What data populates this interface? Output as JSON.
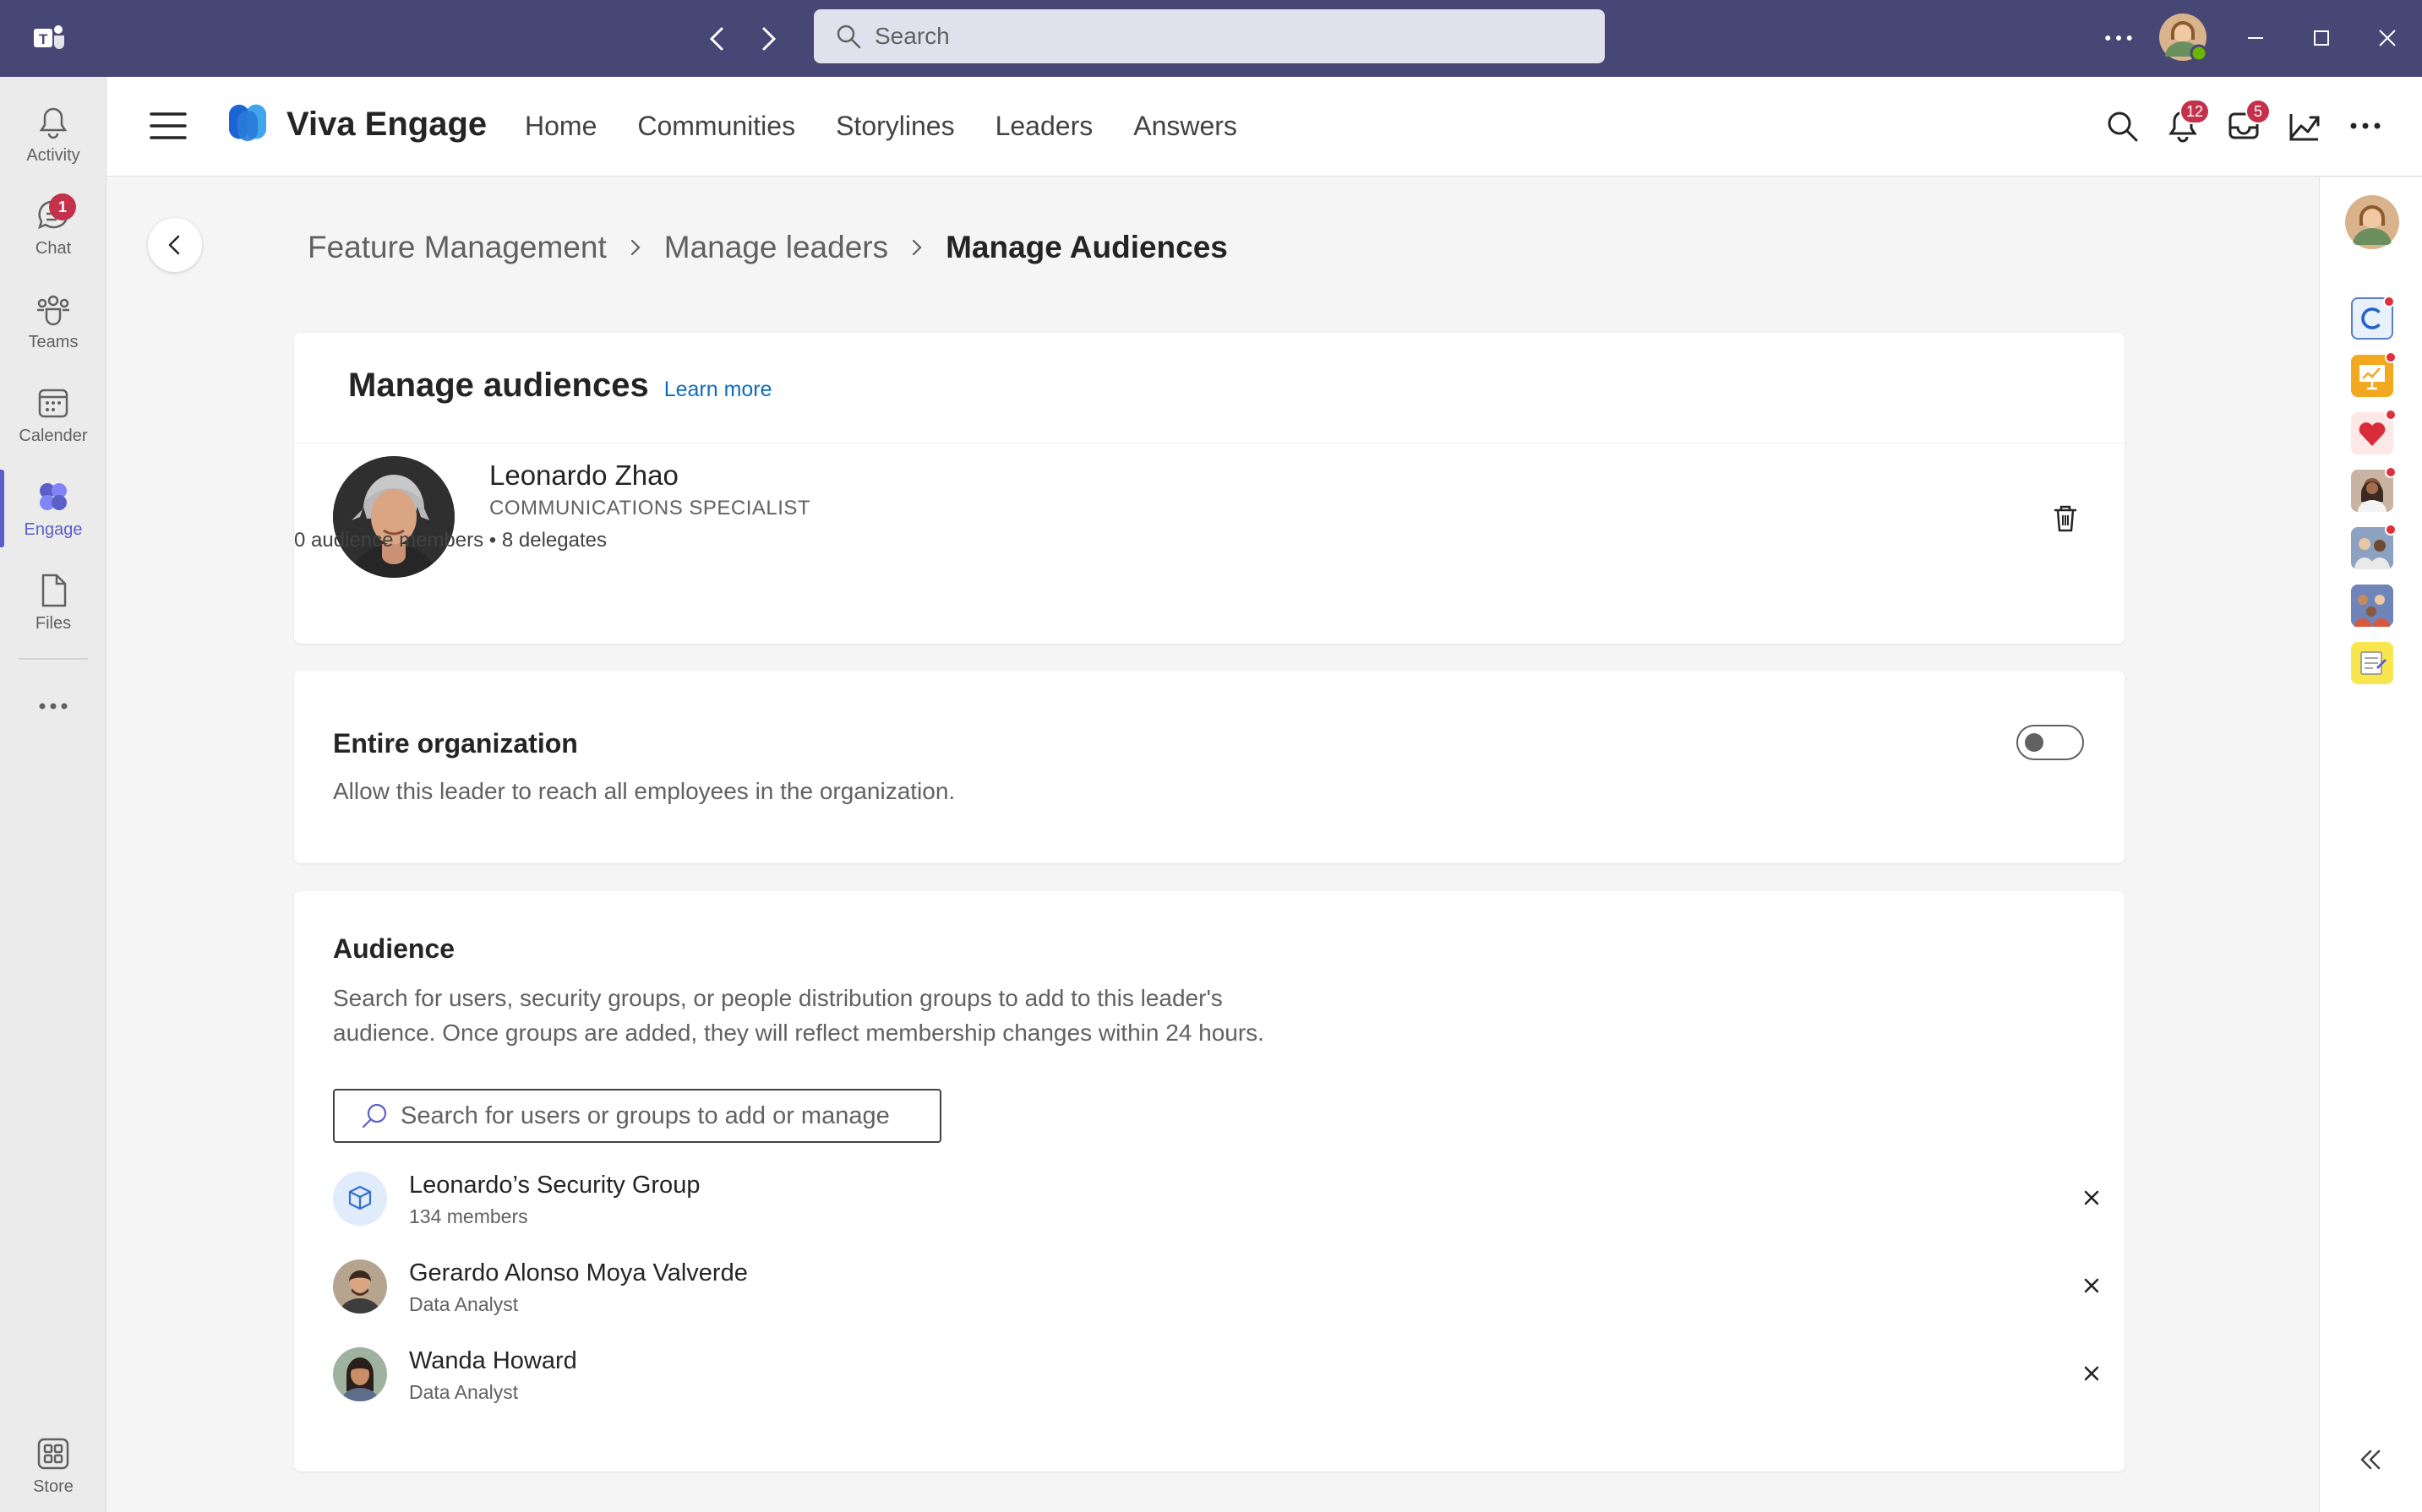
{
  "titlebar": {
    "search_placeholder": "Search",
    "more_icon": "more-horizontal-icon",
    "window_controls": [
      "minimize-icon",
      "maximize-icon",
      "close-icon"
    ]
  },
  "rail": {
    "items": [
      {
        "label": "Activity",
        "icon": "bell-icon"
      },
      {
        "label": "Chat",
        "icon": "chat-icon",
        "badge": "1"
      },
      {
        "label": "Teams",
        "icon": "teams-icon"
      },
      {
        "label": "Calender",
        "icon": "calendar-icon"
      },
      {
        "label": "Engage",
        "icon": "engage-icon",
        "active": true
      },
      {
        "label": "Files",
        "icon": "file-icon"
      }
    ],
    "store_label": "Store"
  },
  "header": {
    "app_name": "Viva Engage",
    "nav": [
      "Home",
      "Communities",
      "Storylines",
      "Leaders",
      "Answers"
    ],
    "notifications_badge": "12",
    "inbox_badge": "5"
  },
  "breadcrumb": {
    "items": [
      "Feature Management",
      "Manage leaders"
    ],
    "current": "Manage Audiences"
  },
  "manage": {
    "title": "Manage audiences",
    "learn_more": "Learn more",
    "leader": {
      "name": "Leonardo Zhao",
      "title": "COMMUNICATIONS SPECIALIST",
      "meta": "0 audience members • 8 delegates"
    }
  },
  "org": {
    "title": "Entire organization",
    "description": "Allow this leader to reach all employees in the organization.",
    "enabled": false
  },
  "audience": {
    "title": "Audience",
    "description_line1": "Search for users, security groups, or people distribution groups to add to this leader's",
    "description_line2": "audience. Once groups are added, they will reflect membership changes within 24 hours.",
    "search_placeholder": "Search for users or groups to add or manage",
    "members": [
      {
        "name": "Leonardo’s Security Group",
        "sub": "134 members",
        "type": "group"
      },
      {
        "name": "Gerardo Alonso Moya Valverde",
        "sub": "Data Analyst",
        "type": "person"
      },
      {
        "name": "Wanda Howard",
        "sub": "Data Analyst",
        "type": "person"
      }
    ]
  },
  "colors": {
    "titlebar": "#464775",
    "accent": "#5b5fc7",
    "badge": "#c4314b",
    "link": "#0f6cbd"
  }
}
